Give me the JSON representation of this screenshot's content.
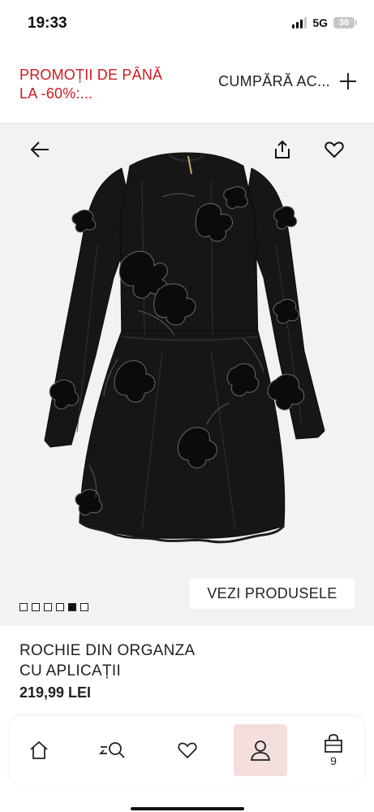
{
  "status_bar": {
    "time": "19:33",
    "network": "5G",
    "battery": "38"
  },
  "promo": {
    "text": "PROMOȚII DE PÂNĂ LA -60%:...",
    "cta_label": "CUMPĂRĂ AC...",
    "cta_icon": "plus-icon",
    "accent_color": "#d0191f"
  },
  "hero": {
    "back_icon": "arrow-left-icon",
    "share_icon": "share-icon",
    "favorite_icon": "heart-icon",
    "view_products_label": "VEZI PRODUSELE",
    "image_count": 6,
    "active_image_index": 4,
    "background_color": "#f3f2f0"
  },
  "product": {
    "name_line1": "ROCHIE DIN ORGANZA",
    "name_line2": "CU APLICAȚII",
    "price": "219,99 LEI"
  },
  "bottom_nav": {
    "items": [
      {
        "name": "home",
        "icon": "home-icon"
      },
      {
        "name": "search",
        "icon": "search-icon"
      },
      {
        "name": "favorites",
        "icon": "heart-icon"
      },
      {
        "name": "account",
        "icon": "user-icon",
        "active": true
      },
      {
        "name": "bag",
        "icon": "shopping-bag-icon",
        "count": "9"
      }
    ],
    "active_color": "#f4dede"
  }
}
